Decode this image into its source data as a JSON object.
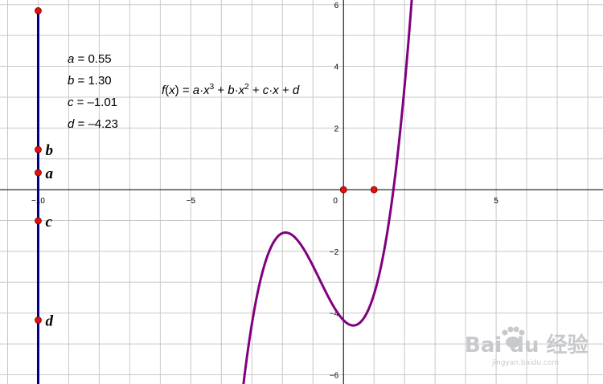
{
  "window": {
    "app": "GeoGebra"
  },
  "colors": {
    "grid": "#c8c8c8",
    "axis": "#000000",
    "curve": "#800080",
    "slider_line": "#00007f",
    "point": "#e01010",
    "watermark": "#c7c9cc"
  },
  "axes": {
    "xlim": [
      -11.25,
      8.5
    ],
    "ylim": [
      -6.3,
      6.15
    ],
    "x_tick_labels": [
      {
        "value": -10,
        "text": "−10"
      },
      {
        "value": -5,
        "text": "−5"
      },
      {
        "value": 0,
        "text": "0"
      },
      {
        "value": 5,
        "text": "5"
      }
    ],
    "y_tick_labels": [
      {
        "value": 6,
        "text": "6"
      },
      {
        "value": 4,
        "text": "4"
      },
      {
        "value": 2,
        "text": "2"
      },
      {
        "value": -2,
        "text": "−2"
      },
      {
        "value": -4,
        "text": "−4"
      },
      {
        "value": -6,
        "text": "−6"
      }
    ],
    "grid": true,
    "grid_step": 1
  },
  "parameters": [
    {
      "name": "a",
      "value_text": "0.55",
      "value": 0.55
    },
    {
      "name": "b",
      "value_text": "1.30",
      "value": 1.3
    },
    {
      "name": "c",
      "value_text": "–1.01",
      "value": -1.01
    },
    {
      "name": "d",
      "value_text": "–4.23",
      "value": -4.23
    }
  ],
  "formula": {
    "lhs_fn": "f",
    "lhs_var": "x",
    "text": "f(x) = a·x³ + b·x² + c·x + d"
  },
  "slider": {
    "x": -10,
    "y_top": 5.8,
    "points": [
      {
        "label": "b",
        "y": 1.3
      },
      {
        "label": "a",
        "y": 0.55
      },
      {
        "label": "c",
        "y": -1.01
      },
      {
        "label": "d",
        "y": -4.23
      }
    ]
  },
  "axis_points": [
    {
      "x": 0,
      "y": 0
    },
    {
      "x": 1,
      "y": 0
    }
  ],
  "chart_data": {
    "type": "line",
    "series": [
      {
        "expression": "0.55x^3 + 1.30x^2 - 1.01x - 4.23",
        "coefficients": {
          "a": 0.55,
          "b": 1.3,
          "c": -1.01,
          "d": -4.23
        }
      }
    ],
    "xlim": [
      -11.25,
      8.5
    ],
    "ylim": [
      -6.3,
      6.15
    ],
    "grid": true
  },
  "watermark": {
    "main": "Bai du 经验",
    "sub": "jingyan.baidu.com"
  }
}
